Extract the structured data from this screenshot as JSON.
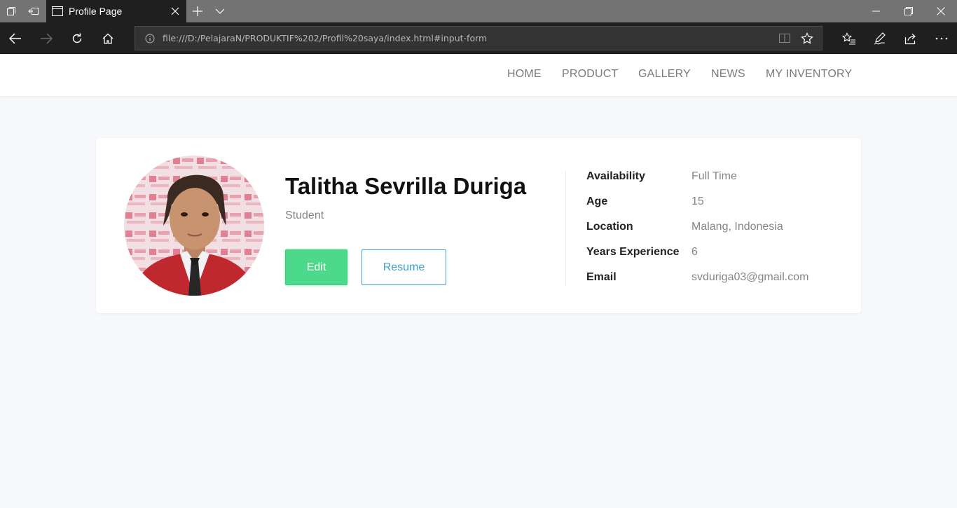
{
  "browser": {
    "tab_title": "Profile Page",
    "url": "file:///D:/PelajaraN/PRODUKTIF%202/Profil%20saya/index.html#input-form"
  },
  "site_nav": {
    "items": [
      "HOME",
      "PRODUCT",
      "GALLERY",
      "NEWS",
      "MY INVENTORY"
    ]
  },
  "profile": {
    "name": "Talitha Sevrilla Duriga",
    "role": "Student",
    "edit_label": "Edit",
    "resume_label": "Resume",
    "details": [
      {
        "label": "Availability",
        "value": "Full Time"
      },
      {
        "label": "Age",
        "value": "15"
      },
      {
        "label": "Location",
        "value": "Malang, Indonesia"
      },
      {
        "label": "Years Experience",
        "value": "6"
      },
      {
        "label": "Email",
        "value": "svduriga03@gmail.com"
      }
    ]
  },
  "colors": {
    "edit_button": "#4cd98c",
    "resume_button": "#3f9fd6",
    "page_background": "#f7f8fb",
    "browser_chrome": "#1f1f1f"
  }
}
